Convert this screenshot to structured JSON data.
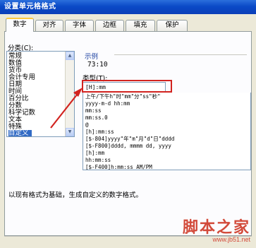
{
  "dialog": {
    "title": "设置单元格格式"
  },
  "tabs": [
    {
      "label": "数字"
    },
    {
      "label": "对齐"
    },
    {
      "label": "字体"
    },
    {
      "label": "边框"
    },
    {
      "label": "填充"
    },
    {
      "label": "保护"
    }
  ],
  "category": {
    "label": "分类(C):",
    "items": [
      "常规",
      "数值",
      "货币",
      "会计专用",
      "日期",
      "时间",
      "百分比",
      "分数",
      "科学记数",
      "文本",
      "特殊",
      "自定义"
    ],
    "selected": "自定义"
  },
  "sample": {
    "label": "示例",
    "value": "73:10"
  },
  "type_field": {
    "label": "类型(T):",
    "value": "[H]:mm"
  },
  "formats": [
    "上午/下午h\"时\"mm\"分\"ss\"秒\"",
    "yyyy-m-d hh:mm",
    "mm:ss",
    "mm:ss.0",
    "@",
    "[h]:mm:ss",
    "[$-804]yyyy\"年\"m\"月\"d\"日\"dddd",
    "[$-F800]dddd, mmmm dd, yyyy",
    "[h]:mm",
    "hh:mm:ss",
    "[$-F400]h:mm:ss AM/PM"
  ],
  "description": "以现有格式为基础，生成自定义的数字格式。",
  "watermark": {
    "text": "脚本之家",
    "url": "www.jb51.net"
  },
  "colors": {
    "annotation": "#d2231f",
    "selection": "#316ac5",
    "titlebar": "#0a4ac7"
  }
}
